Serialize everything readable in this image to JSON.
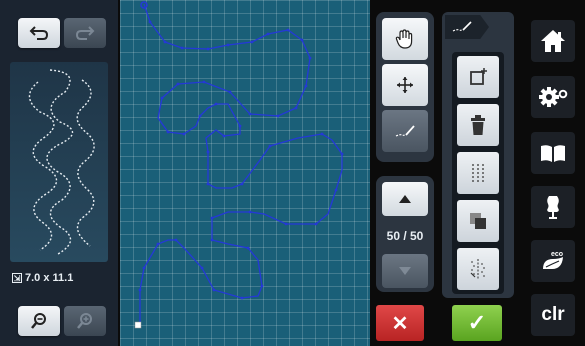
{
  "left_panel": {
    "stitch_size_label": "7.0 x 11.1",
    "size_icon_glyph": "⇲"
  },
  "page_counter": "50 / 50",
  "cancel_glyph": "✕",
  "ok_glyph": "✓",
  "sidebar": {
    "clr_label": "clr",
    "eco_label": "eco"
  },
  "colors": {
    "stitch_line": "#2438d8",
    "canvas": "#1a5f78",
    "cancel": "#d03434",
    "ok": "#74bd36"
  },
  "icons": [
    "undo-icon",
    "redo-icon",
    "zoom-out-icon",
    "zoom-in-icon",
    "hand-icon",
    "move-icon",
    "stitch-line-icon",
    "arrow-up-icon",
    "arrow-down-icon",
    "insert-stitch-icon",
    "delete-icon",
    "grid-dots-icon",
    "duplicate-icon",
    "mirror-icon",
    "home-icon",
    "settings-icon",
    "book-icon",
    "dress-form-icon",
    "eco-icon"
  ]
}
